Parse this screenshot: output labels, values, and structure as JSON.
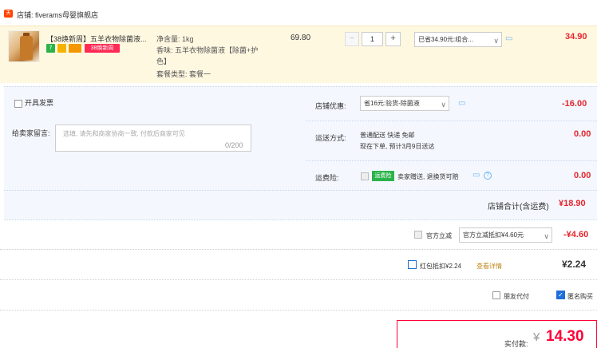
{
  "shop": {
    "icon": "tmall-icon",
    "icon_text": "天猫",
    "label": "店铺: fiverams母婴旗舰店"
  },
  "item": {
    "title": "【38焕新周】五羊衣物除菌液...",
    "badges": [
      "7",
      "",
      "",
      "38焕新周"
    ],
    "sku_lines": [
      "净含量: 1kg",
      "香味: 五羊衣物除菌液【除菌+护",
      "色】",
      "套餐类型: 套餐一"
    ],
    "price": "69.80",
    "qty_minus": "−",
    "quantity": "1",
    "qty_plus": "+",
    "discount_select": "已省34.90元:组合...",
    "total": "34.90"
  },
  "options": {
    "invoice_label": "开具发票",
    "message_label": "给卖家留言:",
    "message_placeholder": "选填, 请先和商家协商一致, 付款后商家可见",
    "message_count": "0/200",
    "shop_discount_label": "店铺优惠:",
    "shop_discount_select": "省16元:验货-除菌液",
    "shop_discount_amount": "-16.00",
    "shipping_label": "运送方式:",
    "shipping_line1": "普通配送 快递 免邮",
    "shipping_line2": "现在下单, 预计3月9日送达",
    "shipping_amount": "0.00",
    "insurance_label": "运费险:",
    "insurance_tag": "运费险",
    "insurance_text": "卖家赠送, 退换货可赔",
    "insurance_amount": "0.00",
    "store_total_label": "店铺合计(含运费)",
    "store_total": "¥18.90"
  },
  "gov": {
    "label": "官方立减",
    "select": "官方立减抵扣¥4.60元",
    "amount": "-¥4.60"
  },
  "hongbao": {
    "label": "红包抵扣¥2.24",
    "link": "查看详情",
    "amount": "¥2.24"
  },
  "extras": {
    "friend_pay": "朋友代付",
    "anonymous": "匿名购买"
  },
  "payment": {
    "label": "实付款:",
    "yen": "¥",
    "amount": "14.30"
  },
  "colors": {
    "accent_red": "#e6252d",
    "pay_red": "#ff0036",
    "link_blue": "#1e6fd9",
    "item_bg": "#fff8e1",
    "options_bg": "#f4f8fe"
  }
}
